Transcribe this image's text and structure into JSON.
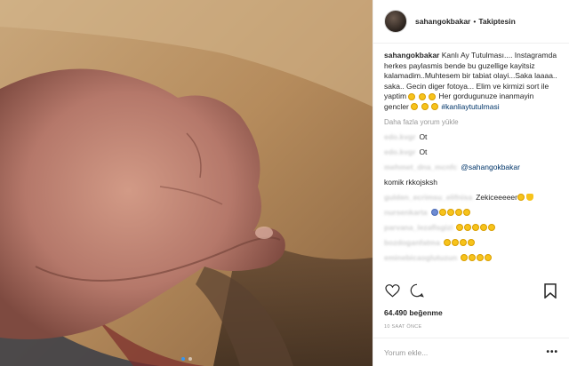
{
  "post": {
    "image_description_icon": "photo-of-fist",
    "carousel_dots": 2
  },
  "header": {
    "username": "sahangokbakar",
    "separator": "•",
    "follow_label": "Takiptesin"
  },
  "caption": {
    "username": "sahangokbakar",
    "text": "Kanlı Ay Tutulması.... Instagramda herkes paylasmis bende bu guzellige kayitsiz kalamadim..Muhtesem bir tabiat olayi...Saka laaaa.. saka.. Gecin diger fotoya... Elim ve kirmizi sort ile yaptim",
    "text2": "Her gordugunuze inanmayin gencler",
    "hashtag": "#kanliaytutulmasi"
  },
  "load_more": "Daha fazla yorum yükle",
  "comments": [
    {
      "user": "edo.kvgr",
      "text": "Ot",
      "mention": "",
      "emojis": 0
    },
    {
      "user": "edo.kvgr",
      "text": "Ot",
      "mention": "",
      "emojis": 0
    },
    {
      "user": "mehmet_dna_mcnfc",
      "text": "",
      "mention": "@sahangokbakar",
      "emojis": 0
    },
    {
      "user": "",
      "text": "komik rkkojsksh",
      "mention": "",
      "emojis": 0
    },
    {
      "user": "gulden_ecrimsu_elifnisa",
      "text": "Zekiceeeeer",
      "mention": "",
      "emojis": 1
    },
    {
      "user": "nursenkarta",
      "text": "",
      "mention": "",
      "emojis": 5
    },
    {
      "user": "parvana_lezaflsgizi",
      "text": "",
      "mention": "",
      "emojis": 5
    },
    {
      "user": "bozdoganfatma",
      "text": "",
      "mention": "",
      "emojis": 4
    },
    {
      "user": "eminebicaoglutuzun",
      "text": "",
      "mention": "",
      "emojis": 4
    }
  ],
  "likes": "64.490 beğenme",
  "timestamp": "10 SAAT ÖNCE",
  "add_comment": {
    "placeholder": "Yorum ekle..."
  },
  "icons": [
    "heart-icon",
    "comment-icon",
    "share-icon",
    "bookmark-icon",
    "more-icon"
  ]
}
